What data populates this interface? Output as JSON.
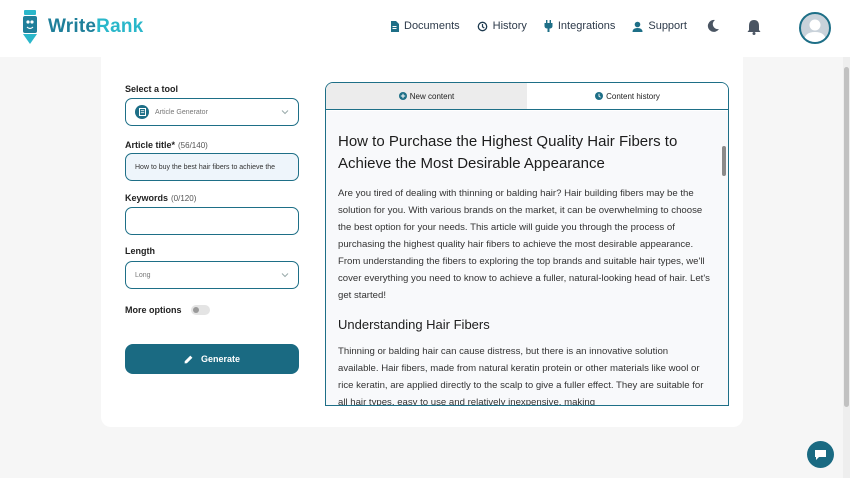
{
  "header": {
    "logo_text_write": "Write",
    "logo_text_rank": "Rank",
    "nav": {
      "documents": "Documents",
      "history": "History",
      "integrations": "Integrations",
      "support": "Support"
    }
  },
  "form": {
    "tool_label": "Select a tool",
    "tool_value": "Article Generator",
    "title_label": "Article title*",
    "title_count": "(56/140)",
    "title_value": "How to buy the best hair fibers to achieve the",
    "keywords_label": "Keywords",
    "keywords_count": "(0/120)",
    "keywords_value": "",
    "length_label": "Length",
    "length_value": "Long",
    "more_options_label": "More options",
    "more_options_on": false,
    "generate_label": "Generate"
  },
  "tabs": {
    "new_content": "New content",
    "content_history": "Content history"
  },
  "article": {
    "title": "How to Purchase the Highest Quality Hair Fibers to Achieve the Most Desirable Appearance",
    "intro": "Are you tired of dealing with thinning or balding hair? Hair building fibers may be the solution for you. With various brands on the market, it can be overwhelming to choose the best option for your needs. This article will guide you through the process of purchasing the highest quality hair fibers to achieve the most desirable appearance. From understanding the fibers to exploring the top brands and suitable hair types, we'll cover everything you need to know to achieve a fuller, natural-looking head of hair. Let's get started!",
    "section1_heading": "Understanding Hair Fibers",
    "section1_body": "Thinning or balding hair can cause distress, but there is an innovative solution available. Hair fibers, made from natural keratin protein or other materials like wool or rice keratin, are applied directly to the scalp to give a fuller effect. They are suitable for all hair types, easy to use and relatively inexpensive, making"
  },
  "colors": {
    "brand": "#1a6a82",
    "accent": "#2ab7ca"
  }
}
